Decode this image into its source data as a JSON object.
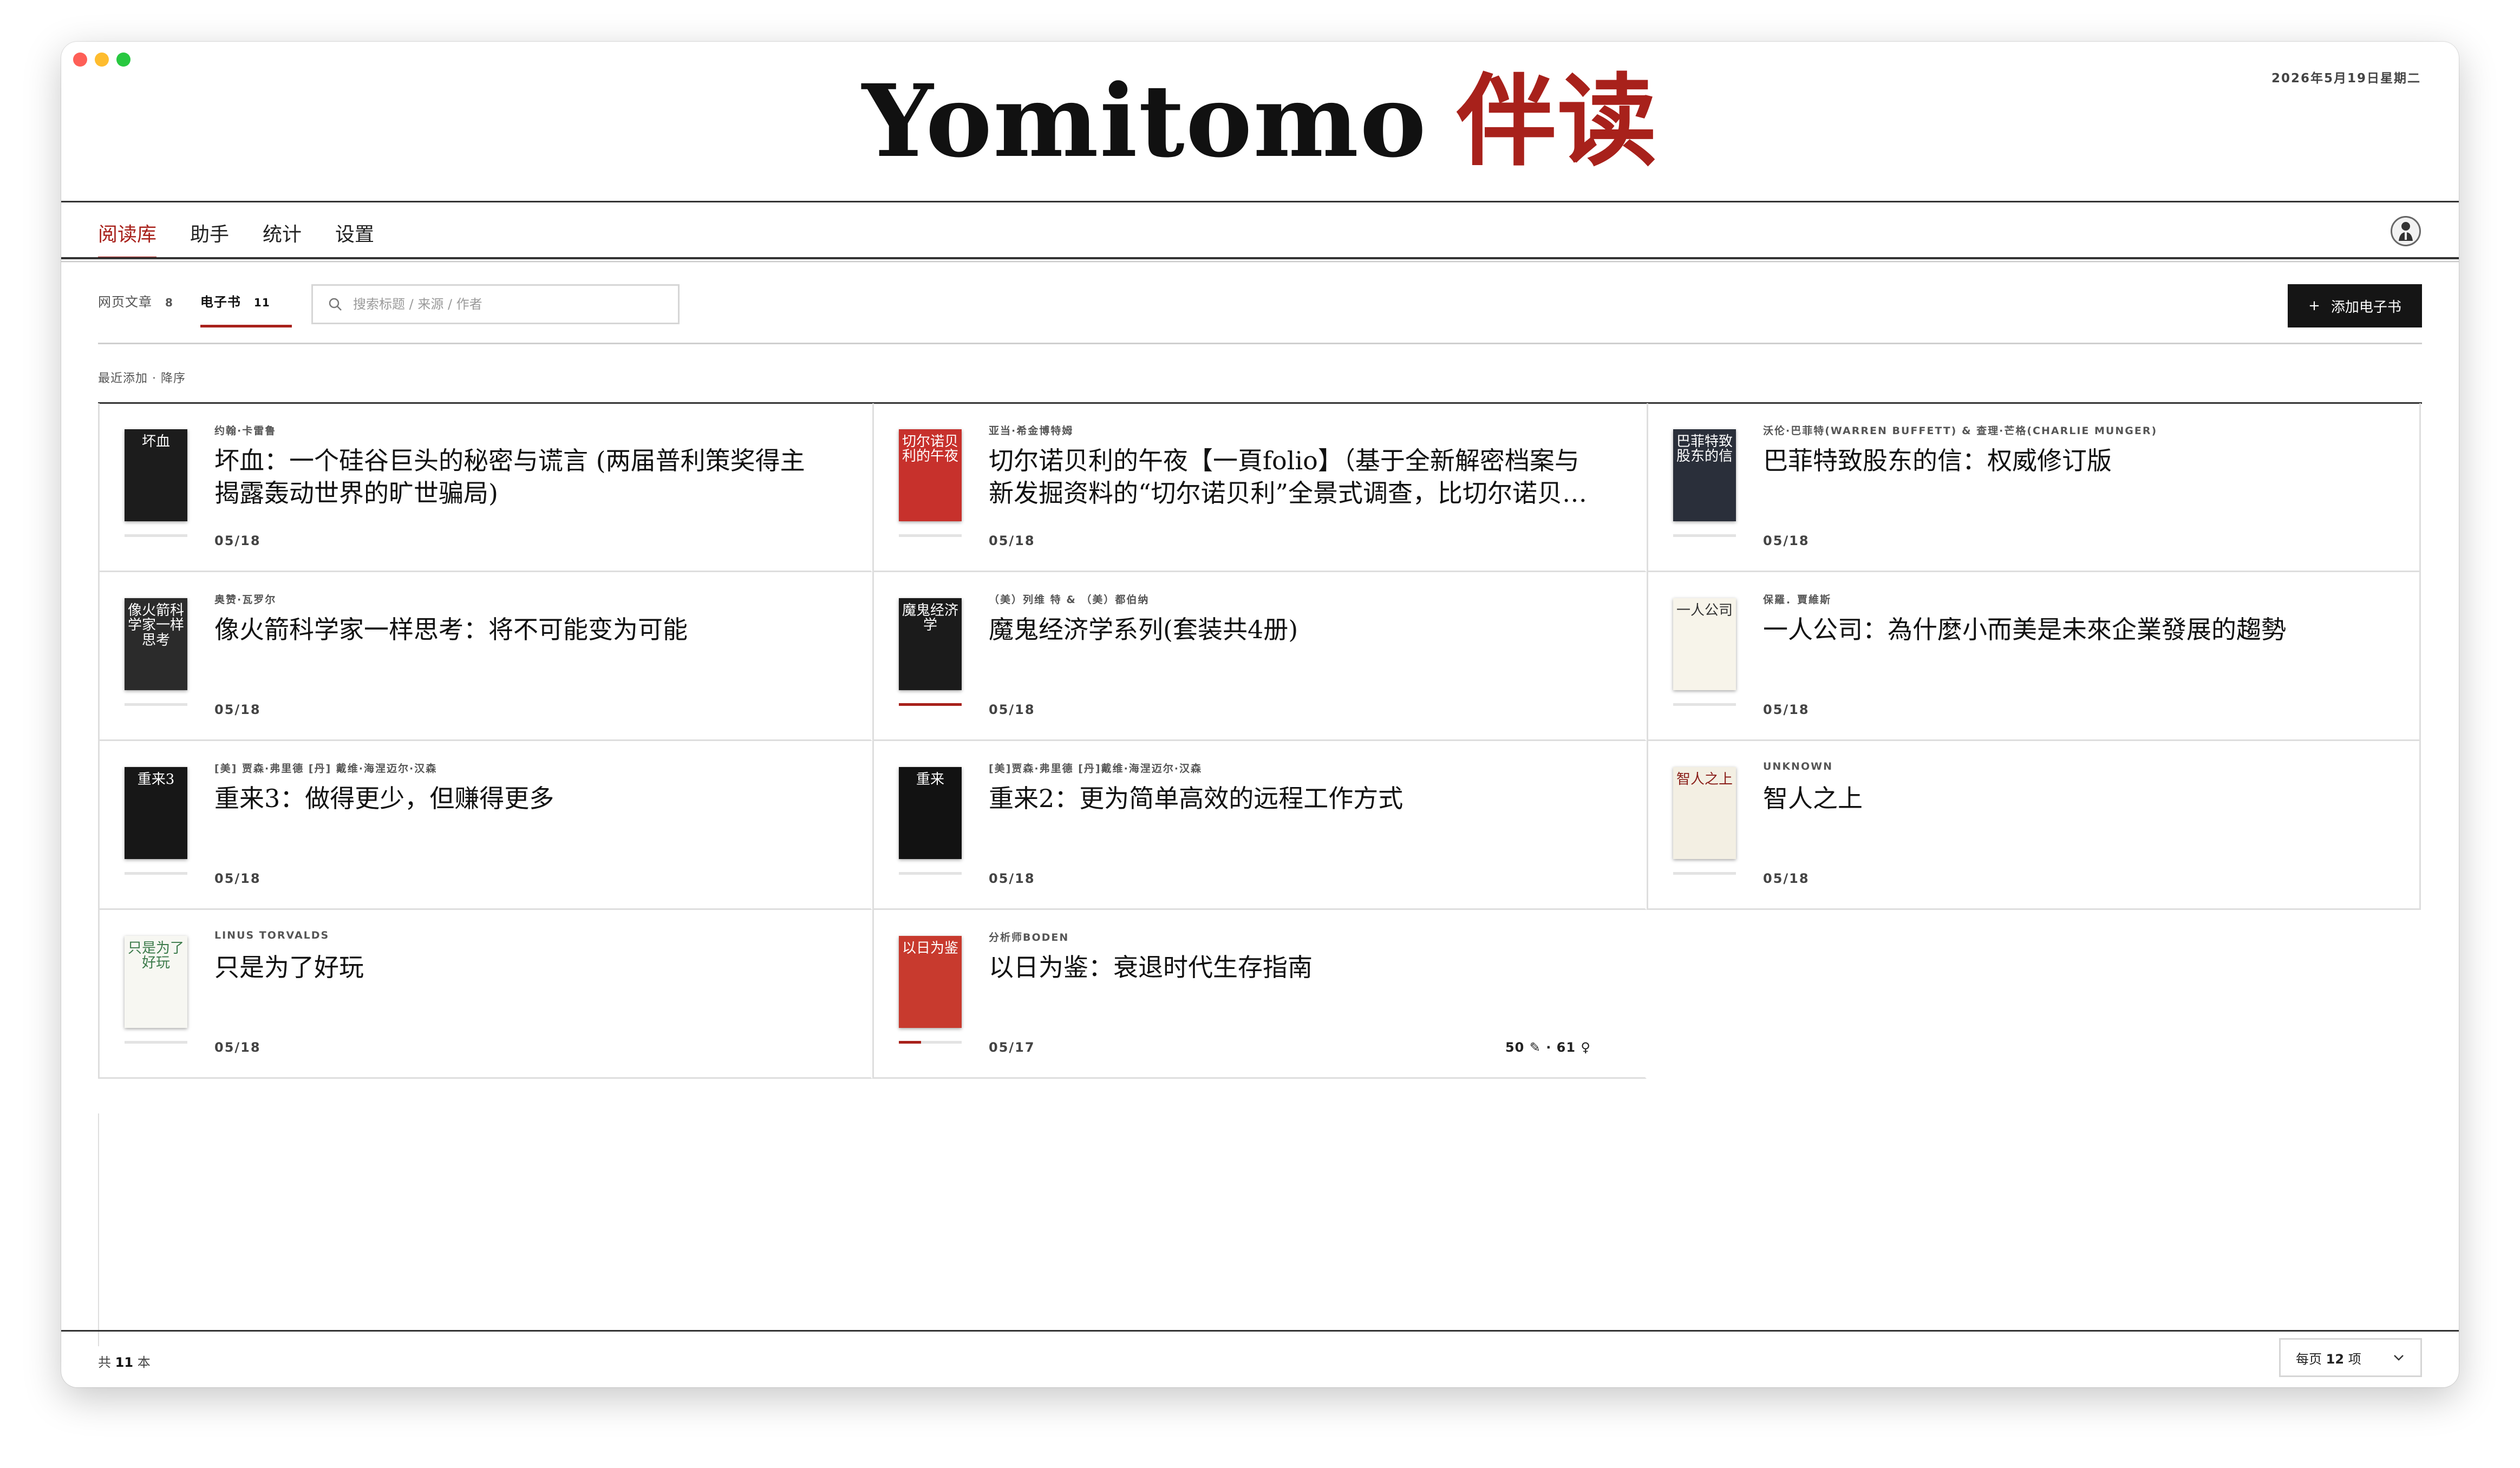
{
  "app": {
    "title_en": "Yomitomo",
    "title_zh": "伴读",
    "date": "2026年5月19日星期二"
  },
  "nav": {
    "tabs": [
      {
        "label": "阅读库",
        "active": true
      },
      {
        "label": "助手",
        "active": false
      },
      {
        "label": "统计",
        "active": false
      },
      {
        "label": "设置",
        "active": false
      }
    ]
  },
  "library": {
    "subtabs": [
      {
        "label": "网页文章",
        "count": "8",
        "active": false
      },
      {
        "label": "电子书",
        "count": "11",
        "active": true
      }
    ],
    "search_placeholder": "搜索标题 / 来源 / 作者",
    "add_button": "添加电子书",
    "sort_label": "最近添加 · 降序"
  },
  "books": [
    {
      "author": "约翰·卡雷鲁",
      "title": "坏血：一个硅谷巨头的秘密与谎言 (两届普利策奖得主揭露轰动世界的旷世骗局)",
      "date": "05/18",
      "cover_text": "坏血",
      "cover_color": "#1c1c1c",
      "cover_text_color": "#ffffff",
      "progress": 0
    },
    {
      "author": "亚当·希金博特姆",
      "title": "切尔诺贝利的午夜【一頁folio】（基于全新解密档案与新发掘资料的“切尔诺贝利”全景式调查，比切尔诺贝利剧集更深刻的揭露)",
      "date": "05/18",
      "cover_text": "切尔诺贝利的午夜",
      "cover_color": "#c7312c",
      "cover_text_color": "#ffffff",
      "progress": 0
    },
    {
      "author": "沃伦·巴菲特(WARREN BUFFETT) & 查理·芒格(CHARLIE MUNGER)",
      "title": "巴菲特致股东的信：权威修订版",
      "date": "05/18",
      "cover_text": "巴菲特致股东的信",
      "cover_color": "#2a2f3a",
      "cover_text_color": "#ffffff",
      "progress": 0
    },
    {
      "author": "奥赞·瓦罗尔",
      "title": "像火箭科学家一样思考：将不可能变为可能",
      "date": "05/18",
      "cover_text": "像火箭科学家一样思考",
      "cover_color": "#2b2b2b",
      "cover_text_color": "#ffffff",
      "progress": 0
    },
    {
      "author": "（美）列维 特 & （美）都伯纳",
      "title": "魔鬼经济学系列(套装共4册)",
      "date": "05/18",
      "cover_text": "魔鬼经济学",
      "cover_color": "#1b1b1b",
      "cover_text_color": "#ffffff",
      "progress": 100
    },
    {
      "author": "保羅．賈維斯",
      "title": "一人公司：為什麼小而美是未來企業發展的趨勢",
      "date": "05/18",
      "cover_text": "一人公司",
      "cover_color": "#f7f4ea",
      "cover_text_color": "#333333",
      "progress": 0
    },
    {
      "author": "[美] 贾森·弗里德 [丹] 戴维·海涅迈尔·汉森",
      "title": "重来3：做得更少，但赚得更多",
      "date": "05/18",
      "cover_text": "重来3",
      "cover_color": "#171717",
      "cover_text_color": "#ffffff",
      "progress": 0
    },
    {
      "author": "[美]贾森·弗里德 [丹]戴维·海涅迈尔·汉森",
      "title": "重来2：更为简单高效的远程工作方式",
      "date": "05/18",
      "cover_text": "重来",
      "cover_color": "#121212",
      "cover_text_color": "#ffffff",
      "progress": 0
    },
    {
      "author": "UNKNOWN",
      "title": "智人之上",
      "date": "05/18",
      "cover_text": "智人之上",
      "cover_color": "#f3efe3",
      "cover_text_color": "#8a1f1a",
      "progress": 0
    },
    {
      "author": "LINUS TORVALDS",
      "title": "只是为了好玩",
      "date": "05/18",
      "cover_text": "只是为了好玩",
      "cover_color": "#f7f7f2",
      "cover_text_color": "#3b7a4a",
      "progress": 0
    },
    {
      "author": "分析师BODEN",
      "title": "以日为鉴：衰退时代生存指南",
      "date": "05/17",
      "cover_text": "以日为鉴",
      "cover_color": "#c83a2e",
      "cover_text_color": "#ffffff",
      "progress": 35,
      "stats": "50 ✎ · 61 ♀"
    }
  ],
  "footer": {
    "count_prefix": "共",
    "count": "11",
    "count_suffix": "本",
    "page_size_prefix": "每页",
    "page_size": "12",
    "page_size_suffix": "项"
  },
  "colors": {
    "accent": "#a8211b",
    "button_bg": "#151515"
  }
}
